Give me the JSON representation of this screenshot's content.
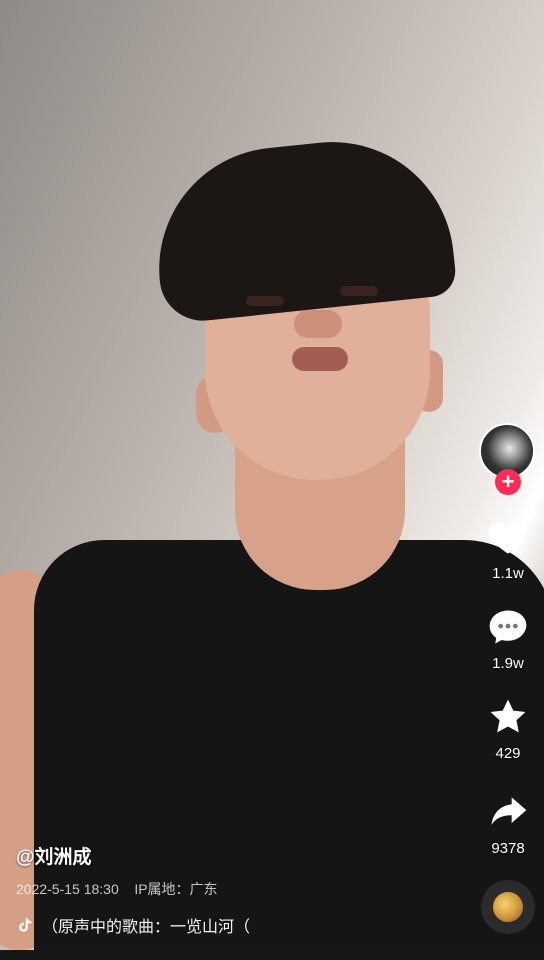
{
  "caption": {
    "author": "@刘洲成",
    "timestamp": "2022-5-15 18:30",
    "ip_location": "IP属地：广东",
    "music_text": "（原声中的歌曲：一览山河（"
  },
  "actions": {
    "likes": "1.1w",
    "comments": "1.9w",
    "favorites": "429",
    "shares": "9378"
  },
  "icons": {
    "follow": "plus-icon",
    "like": "heart-icon",
    "comment": "comment-icon",
    "favorite": "star-icon",
    "share": "share-icon",
    "music": "music-note-icon"
  },
  "colors": {
    "follow_button": "#fe2c55",
    "icon_fill": "#ffffff"
  }
}
